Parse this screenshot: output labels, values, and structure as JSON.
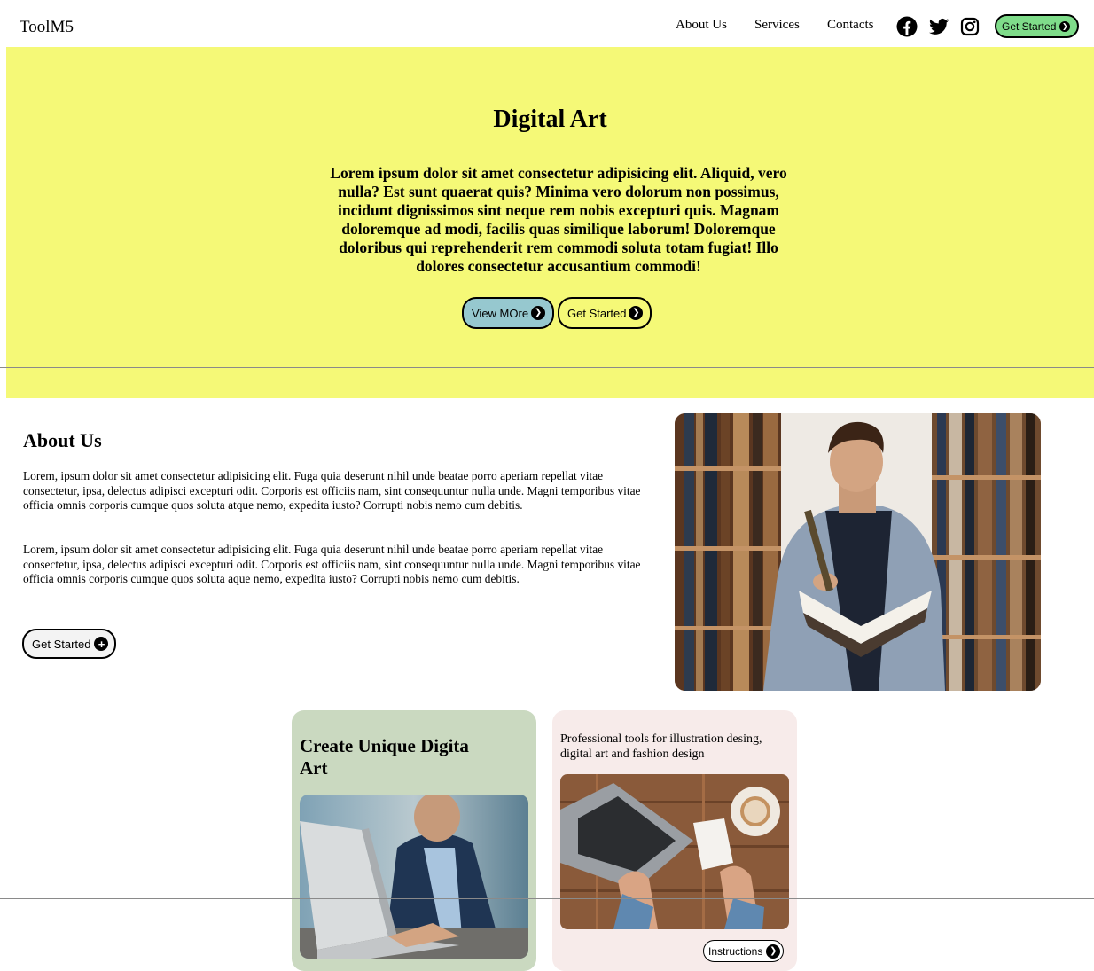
{
  "nav": {
    "brand": "ToolM5",
    "links": [
      "About Us",
      "Services",
      "Contacts"
    ],
    "social": [
      "facebook-icon",
      "twitter-icon",
      "instagram-icon"
    ],
    "cta_label": "Get Started"
  },
  "hero": {
    "title": "Digital Art",
    "text": "Lorem ipsum dolor sit amet consectetur adipisicing elit. Aliquid, vero nulla? Est sunt quaerat quis? Minima vero dolorum non possimus, incidunt dignissimos sint neque rem nobis excepturi quis. Magnam doloremque ad modi, facilis quas similique laborum! Doloremque doloribus qui reprehenderit rem commodi soluta totam fugiat! Illo dolores consectetur accusantium commodi!",
    "view_more_label": "View MOre",
    "get_started_label": "Get Started"
  },
  "about": {
    "title": "About Us",
    "paragraphs": [
      "Lorem, ipsum dolor sit amet consectetur adipisicing elit. Fuga quia deserunt nihil unde beatae porro aperiam repellat vitae consectetur, ipsa, delectus adipisci excepturi odit. Corporis est officiis nam, sint consequuntur nulla unde. Magni temporibus vitae officia omnis corporis cumque quos soluta atque nemo, expedita iusto? Corrupti nobis nemo cum debitis.",
      "Lorem, ipsum dolor sit amet consectetur adipisicing elit. Fuga quia deserunt nihil unde beatae porro aperiam repellat vitae consectetur, ipsa, delectus adipisci excepturi odit. Corporis est officiis nam, sint consequuntur nulla unde. Magni temporibus vitae officia omnis corporis cumque quos soluta aque nemo, expedita iusto? Corrupti nobis nemo cum debitis."
    ],
    "cta_label": "Get Started"
  },
  "cards": {
    "green_title": "Create Unique Digita Art",
    "pink_desc": "Professional tools for illustration desing, digital art and fashion design",
    "instructions_label": "Instructions"
  },
  "colors": {
    "hero_bg": "#f5f977",
    "view_more_bg": "#96c8cf",
    "nav_cta_bg": "#7fdc8a",
    "card_green_bg": "#cad9c0",
    "card_pink_bg": "#f7ebea"
  }
}
